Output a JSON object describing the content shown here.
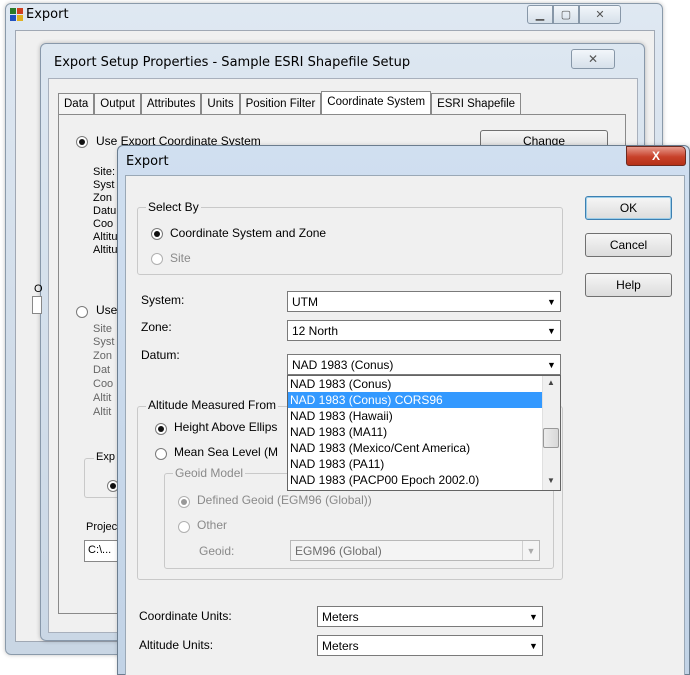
{
  "outer_window": {
    "title": "Export"
  },
  "setup_window": {
    "title": "Export Setup Properties - Sample ESRI Shapefile Setup",
    "tabs": [
      {
        "label": "Data"
      },
      {
        "label": "Output"
      },
      {
        "label": "Attributes"
      },
      {
        "label": "Units"
      },
      {
        "label": "Position Filter"
      },
      {
        "label": "Coordinate System",
        "active": true
      },
      {
        "label": "ESRI Shapefile"
      }
    ],
    "use_export_cs_label": "Use Export Coordinate System",
    "change_button": "Change",
    "visible_fragments": {
      "site": "Site:",
      "syst": "Syst",
      "zone": "Zon",
      "datum": "Datu",
      "coord": "Coo",
      "alti1": "Altitu",
      "alti2": "Altitu",
      "o": "O",
      "use": "Use",
      "site2": "Site",
      "syst2": "Syst",
      "zone2": "Zon",
      "datum2": "Dat",
      "coord2": "Coo",
      "alti3": "Altit",
      "alti4": "Altit",
      "exp": "Exp",
      "proj": "Projec",
      "path": "C:\\..."
    }
  },
  "dialog": {
    "title": "Export",
    "close": "X",
    "select_by": {
      "legend": "Select By",
      "options": [
        {
          "label": "Coordinate System and Zone",
          "checked": true,
          "enabled": true
        },
        {
          "label": "Site",
          "checked": false,
          "enabled": false
        }
      ]
    },
    "system_label": "System:",
    "system_value": "UTM",
    "zone_label": "Zone:",
    "zone_value": "12 North",
    "datum_label": "Datum:",
    "datum_value": "NAD 1983 (Conus)",
    "datum_options": [
      "NAD 1983 (Conus)",
      "NAD 1983 (Conus) CORS96",
      "NAD 1983 (Hawaii)",
      "NAD 1983 (MA11)",
      "NAD 1983 (Mexico/Cent America)",
      "NAD 1983 (PA11)",
      "NAD 1983 (PACP00 Epoch 2002.0)"
    ],
    "datum_selected_index": 1,
    "altitude": {
      "legend": "Altitude Measured From",
      "height_above": "Height Above Ellips",
      "msl": "Mean Sea Level (M",
      "geoid_model_legend": "Geoid Model",
      "defined_geoid": "Defined Geoid (EGM96 (Global))",
      "other": "Other",
      "geoid_label": "Geoid:",
      "geoid_value": "EGM96 (Global)"
    },
    "coordinate_units_label": "Coordinate Units:",
    "coordinate_units_value": "Meters",
    "altitude_units_label": "Altitude Units:",
    "altitude_units_value": "Meters",
    "ok": "OK",
    "cancel": "Cancel",
    "help": "Help"
  }
}
